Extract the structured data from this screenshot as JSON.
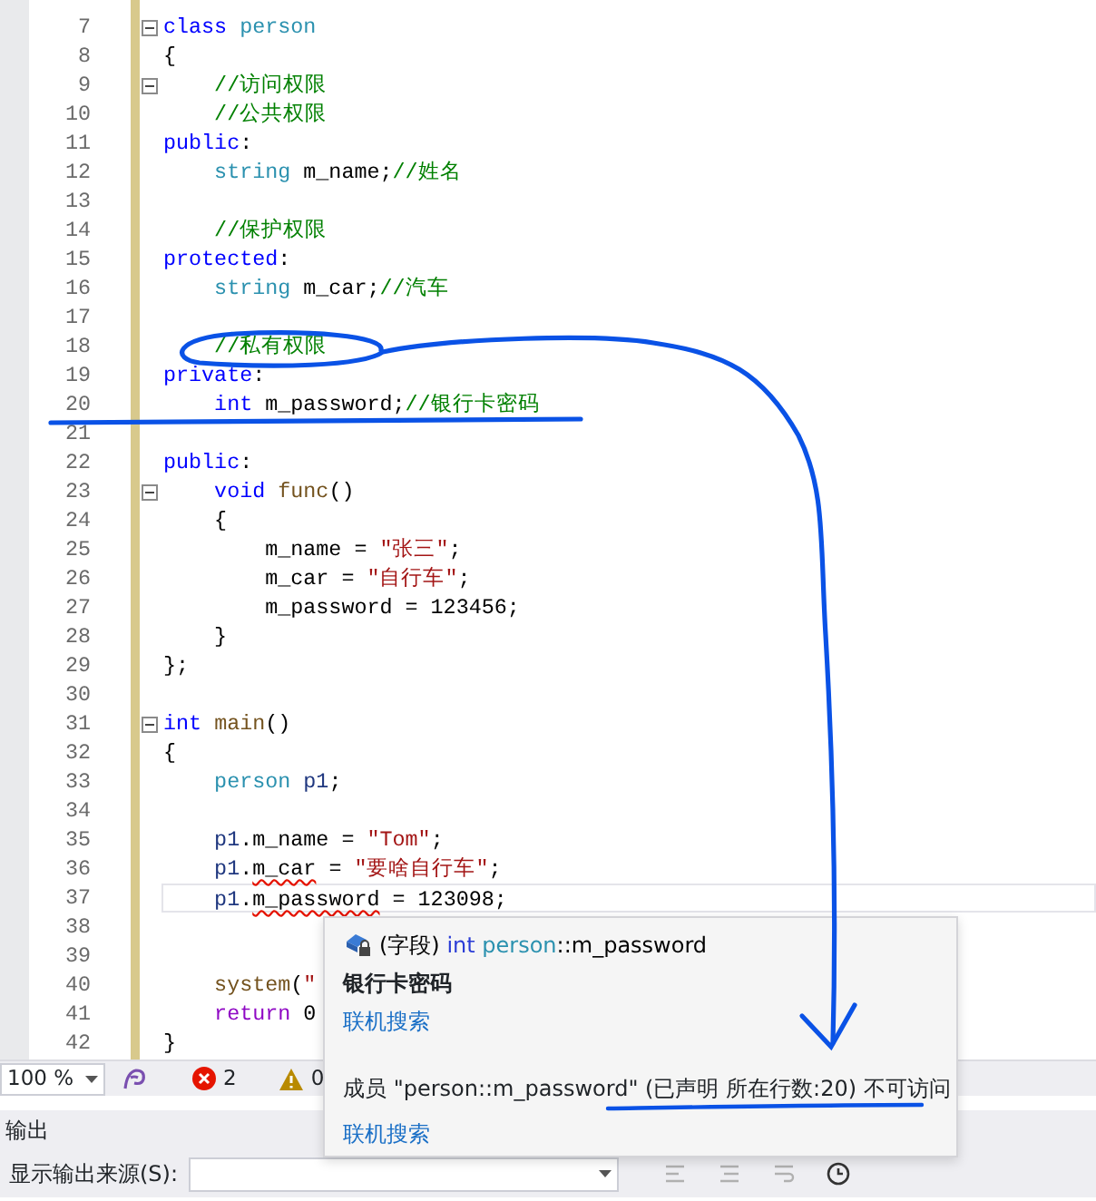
{
  "editor": {
    "lines": [
      {
        "num": "7",
        "fold": true,
        "current": false,
        "tokens": [
          {
            "t": "class ",
            "kind": "kw"
          },
          {
            "t": "person",
            "kind": "type"
          }
        ]
      },
      {
        "num": "8",
        "fold": false,
        "current": false,
        "tokens": [
          {
            "t": "{",
            "kind": "plain"
          }
        ]
      },
      {
        "num": "9",
        "fold": true,
        "current": false,
        "tokens": [
          {
            "t": "    //访问权限",
            "kind": "cm"
          }
        ]
      },
      {
        "num": "10",
        "fold": false,
        "current": false,
        "tokens": [
          {
            "t": "    //公共权限",
            "kind": "cm"
          }
        ]
      },
      {
        "num": "11",
        "fold": false,
        "current": false,
        "tokens": [
          {
            "t": "public",
            "kind": "kw"
          },
          {
            "t": ":",
            "kind": "plain"
          }
        ]
      },
      {
        "num": "12",
        "fold": false,
        "current": false,
        "tokens": [
          {
            "t": "    string",
            "kind": "type"
          },
          {
            "t": " m_name;",
            "kind": "plain"
          },
          {
            "t": "//姓名",
            "kind": "cm"
          }
        ]
      },
      {
        "num": "13",
        "fold": false,
        "current": false
      },
      {
        "num": "14",
        "fold": false,
        "current": false,
        "tokens": [
          {
            "t": "    //保护权限",
            "kind": "cm"
          }
        ]
      },
      {
        "num": "15",
        "fold": false,
        "current": false,
        "tokens": [
          {
            "t": "protected",
            "kind": "kw"
          },
          {
            "t": ":",
            "kind": "plain"
          }
        ]
      },
      {
        "num": "16",
        "fold": false,
        "current": false,
        "tokens": [
          {
            "t": "    string",
            "kind": "type"
          },
          {
            "t": " m_car;",
            "kind": "plain"
          },
          {
            "t": "//汽车",
            "kind": "cm"
          }
        ]
      },
      {
        "num": "17",
        "fold": false,
        "current": false
      },
      {
        "num": "18",
        "fold": false,
        "current": false,
        "tokens": [
          {
            "t": "    //私有权限",
            "kind": "cm"
          }
        ]
      },
      {
        "num": "19",
        "fold": false,
        "current": false,
        "tokens": [
          {
            "t": "private",
            "kind": "kw"
          },
          {
            "t": ":",
            "kind": "plain"
          }
        ]
      },
      {
        "num": "20",
        "fold": false,
        "current": false,
        "tokens": [
          {
            "t": "    int",
            "kind": "kw"
          },
          {
            "t": " m_password;",
            "kind": "plain"
          },
          {
            "t": "//银行卡密码",
            "kind": "cm"
          }
        ]
      },
      {
        "num": "21",
        "fold": false,
        "current": false
      },
      {
        "num": "22",
        "fold": false,
        "current": false,
        "tokens": [
          {
            "t": "public",
            "kind": "kw"
          },
          {
            "t": ":",
            "kind": "plain"
          }
        ]
      },
      {
        "num": "23",
        "fold": true,
        "current": false,
        "tokens": [
          {
            "t": "    void ",
            "kind": "kw"
          },
          {
            "t": "func",
            "kind": "fn"
          },
          {
            "t": "()",
            "kind": "plain"
          }
        ]
      },
      {
        "num": "24",
        "fold": false,
        "current": false,
        "tokens": [
          {
            "t": "    {",
            "kind": "plain"
          }
        ]
      },
      {
        "num": "25",
        "fold": false,
        "current": false,
        "tokens": [
          {
            "t": "        m_name = ",
            "kind": "plain"
          },
          {
            "t": "\"张三\"",
            "kind": "str"
          },
          {
            "t": ";",
            "kind": "plain"
          }
        ]
      },
      {
        "num": "26",
        "fold": false,
        "current": false,
        "tokens": [
          {
            "t": "        m_car = ",
            "kind": "plain"
          },
          {
            "t": "\"自行车\"",
            "kind": "str"
          },
          {
            "t": ";",
            "kind": "plain"
          }
        ]
      },
      {
        "num": "27",
        "fold": false,
        "current": false,
        "tokens": [
          {
            "t": "        m_password = 123456;",
            "kind": "plain"
          }
        ]
      },
      {
        "num": "28",
        "fold": false,
        "current": false,
        "tokens": [
          {
            "t": "    }",
            "kind": "plain"
          }
        ]
      },
      {
        "num": "29",
        "fold": false,
        "current": false,
        "tokens": [
          {
            "t": "};",
            "kind": "plain"
          }
        ]
      },
      {
        "num": "30",
        "fold": false,
        "current": false
      },
      {
        "num": "31",
        "fold": true,
        "current": false,
        "tokens": [
          {
            "t": "int ",
            "kind": "kw"
          },
          {
            "t": "main",
            "kind": "fn"
          },
          {
            "t": "()",
            "kind": "plain"
          }
        ]
      },
      {
        "num": "32",
        "fold": false,
        "current": false,
        "tokens": [
          {
            "t": "{",
            "kind": "plain"
          }
        ]
      },
      {
        "num": "33",
        "fold": false,
        "current": false,
        "tokens": [
          {
            "t": "    person ",
            "kind": "type"
          },
          {
            "t": "p1",
            "kind": "var"
          },
          {
            "t": ";",
            "kind": "plain"
          }
        ]
      },
      {
        "num": "34",
        "fold": false,
        "current": false
      },
      {
        "num": "35",
        "fold": false,
        "current": false,
        "tokens": [
          {
            "t": "    p1",
            "kind": "var"
          },
          {
            "t": ".m_name = ",
            "kind": "plain"
          },
          {
            "t": "\"Tom\"",
            "kind": "str"
          },
          {
            "t": ";",
            "kind": "plain"
          }
        ]
      },
      {
        "num": "36",
        "fold": false,
        "current": false,
        "tokens": [
          {
            "t": "    p1",
            "kind": "var"
          },
          {
            "t": ".",
            "kind": "plain"
          },
          {
            "t": "m_car",
            "kind": "plain",
            "error": true
          },
          {
            "t": " = ",
            "kind": "plain"
          },
          {
            "t": "\"要啥自行车\"",
            "kind": "str"
          },
          {
            "t": ";",
            "kind": "plain"
          }
        ]
      },
      {
        "num": "37",
        "fold": false,
        "current": true,
        "tokens": [
          {
            "t": "    p1",
            "kind": "var"
          },
          {
            "t": ".",
            "kind": "plain"
          },
          {
            "t": "m_password",
            "kind": "plain",
            "error": true
          },
          {
            "t": " = 123098;",
            "kind": "plain"
          }
        ]
      },
      {
        "num": "38",
        "fold": false,
        "current": false
      },
      {
        "num": "39",
        "fold": false,
        "current": false
      },
      {
        "num": "40",
        "fold": false,
        "current": false,
        "tokens": [
          {
            "t": "    system",
            "kind": "fn"
          },
          {
            "t": "(",
            "kind": "plain"
          },
          {
            "t": "\"",
            "kind": "str"
          }
        ]
      },
      {
        "num": "41",
        "fold": false,
        "current": false,
        "tokens": [
          {
            "t": "    return",
            "kind": "ctl"
          },
          {
            "t": " 0",
            "kind": "plain"
          }
        ]
      },
      {
        "num": "42",
        "fold": false,
        "current": false,
        "tokens": [
          {
            "t": "}",
            "kind": "plain"
          }
        ]
      }
    ]
  },
  "status_bar": {
    "zoom": "100 %",
    "errors": "2",
    "warnings": "0"
  },
  "tooltip": {
    "signature": [
      {
        "t": "(字段) ",
        "kind": "plain"
      },
      {
        "t": "int ",
        "kind": "kw"
      },
      {
        "t": "person",
        "kind": "type"
      },
      {
        "t": "::m_password",
        "kind": "plain"
      }
    ],
    "description": "银行卡密码",
    "link_1": "联机搜索",
    "error_message": "成员 \"person::m_password\" (已声明 所在行数:20) 不可访问",
    "link_2": "联机搜索"
  },
  "output_panel": {
    "title": "输出",
    "source_label": "显示输出来源(S):"
  }
}
